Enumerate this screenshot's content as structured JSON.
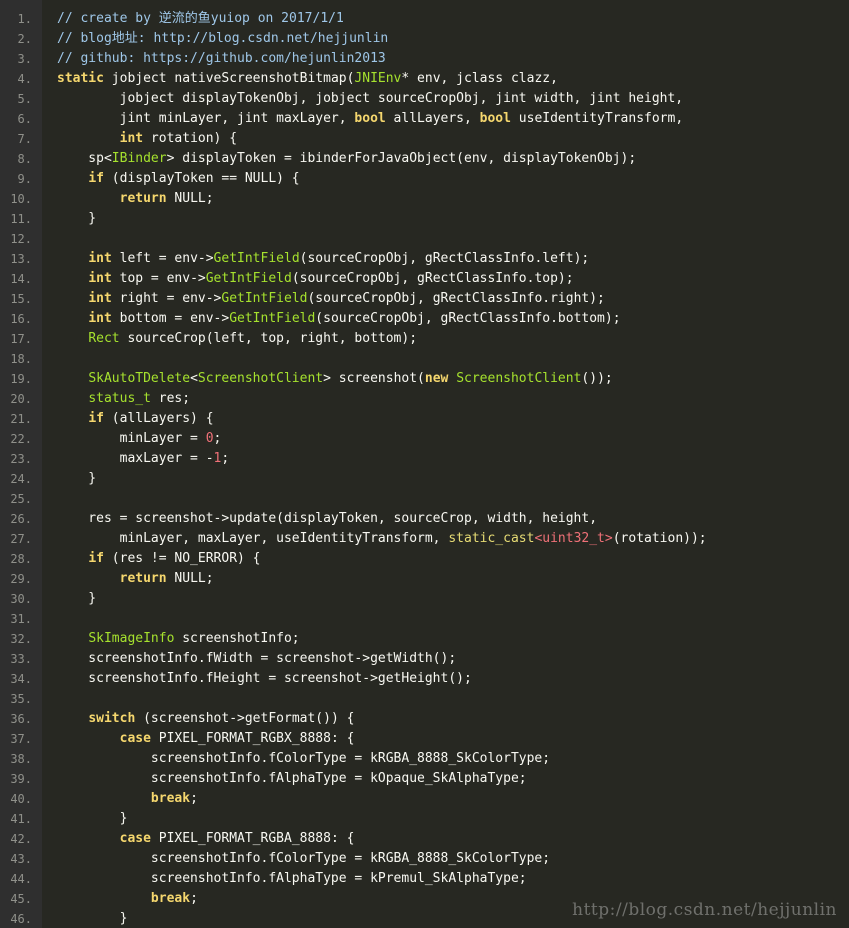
{
  "editor": {
    "lines": [
      {
        "n": "1.",
        "tokens": [
          {
            "t": "// create by 逆流的鱼yuiop on 2017/1/1",
            "c": "comment"
          }
        ]
      },
      {
        "n": "2.",
        "tokens": [
          {
            "t": "// blog地址: http://blog.csdn.net/hejjunlin",
            "c": "comment"
          }
        ]
      },
      {
        "n": "3.",
        "tokens": [
          {
            "t": "// github: https://github.com/hejunlin2013",
            "c": "comment"
          }
        ]
      },
      {
        "n": "4.",
        "tokens": [
          {
            "t": "static",
            "c": "keyword"
          },
          {
            "t": " jobject nativeScreenshotBitmap(",
            "c": "plain"
          },
          {
            "t": "JNIEnv",
            "c": "type"
          },
          {
            "t": "* env, jclass clazz,",
            "c": "plain"
          }
        ]
      },
      {
        "n": "5.",
        "tokens": [
          {
            "t": "        jobject displayTokenObj, jobject sourceCropObj, jint width, jint height,",
            "c": "plain"
          }
        ]
      },
      {
        "n": "6.",
        "tokens": [
          {
            "t": "        jint minLayer, jint maxLayer, ",
            "c": "plain"
          },
          {
            "t": "bool",
            "c": "keyword"
          },
          {
            "t": " allLayers, ",
            "c": "plain"
          },
          {
            "t": "bool",
            "c": "keyword"
          },
          {
            "t": " useIdentityTransform,",
            "c": "plain"
          }
        ]
      },
      {
        "n": "7.",
        "tokens": [
          {
            "t": "        ",
            "c": "plain"
          },
          {
            "t": "int",
            "c": "keyword"
          },
          {
            "t": " rotation) {",
            "c": "plain"
          }
        ]
      },
      {
        "n": "8.",
        "tokens": [
          {
            "t": "    sp<",
            "c": "plain"
          },
          {
            "t": "IBinder",
            "c": "type"
          },
          {
            "t": "> displayToken = ibinderForJavaObject(env, displayTokenObj);",
            "c": "plain"
          }
        ]
      },
      {
        "n": "9.",
        "tokens": [
          {
            "t": "    ",
            "c": "plain"
          },
          {
            "t": "if",
            "c": "keyword"
          },
          {
            "t": " (displayToken == NULL) {",
            "c": "plain"
          }
        ]
      },
      {
        "n": "10.",
        "tokens": [
          {
            "t": "        ",
            "c": "plain"
          },
          {
            "t": "return",
            "c": "keyword"
          },
          {
            "t": " NULL;",
            "c": "plain"
          }
        ]
      },
      {
        "n": "11.",
        "tokens": [
          {
            "t": "    }",
            "c": "plain"
          }
        ]
      },
      {
        "n": "12.",
        "tokens": []
      },
      {
        "n": "13.",
        "tokens": [
          {
            "t": "    ",
            "c": "plain"
          },
          {
            "t": "int",
            "c": "keyword"
          },
          {
            "t": " left = env->",
            "c": "plain"
          },
          {
            "t": "GetIntField",
            "c": "type"
          },
          {
            "t": "(sourceCropObj, gRectClassInfo.left);",
            "c": "plain"
          }
        ]
      },
      {
        "n": "14.",
        "tokens": [
          {
            "t": "    ",
            "c": "plain"
          },
          {
            "t": "int",
            "c": "keyword"
          },
          {
            "t": " top = env->",
            "c": "plain"
          },
          {
            "t": "GetIntField",
            "c": "type"
          },
          {
            "t": "(sourceCropObj, gRectClassInfo.top);",
            "c": "plain"
          }
        ]
      },
      {
        "n": "15.",
        "tokens": [
          {
            "t": "    ",
            "c": "plain"
          },
          {
            "t": "int",
            "c": "keyword"
          },
          {
            "t": " right = env->",
            "c": "plain"
          },
          {
            "t": "GetIntField",
            "c": "type"
          },
          {
            "t": "(sourceCropObj, gRectClassInfo.right);",
            "c": "plain"
          }
        ]
      },
      {
        "n": "16.",
        "tokens": [
          {
            "t": "    ",
            "c": "plain"
          },
          {
            "t": "int",
            "c": "keyword"
          },
          {
            "t": " bottom = env->",
            "c": "plain"
          },
          {
            "t": "GetIntField",
            "c": "type"
          },
          {
            "t": "(sourceCropObj, gRectClassInfo.bottom);",
            "c": "plain"
          }
        ]
      },
      {
        "n": "17.",
        "tokens": [
          {
            "t": "    ",
            "c": "plain"
          },
          {
            "t": "Rect",
            "c": "type"
          },
          {
            "t": " sourceCrop(left, top, right, bottom);",
            "c": "plain"
          }
        ]
      },
      {
        "n": "18.",
        "tokens": []
      },
      {
        "n": "19.",
        "tokens": [
          {
            "t": "    ",
            "c": "plain"
          },
          {
            "t": "SkAutoTDelete",
            "c": "type"
          },
          {
            "t": "<",
            "c": "plain"
          },
          {
            "t": "ScreenshotClient",
            "c": "type"
          },
          {
            "t": "> screenshot(",
            "c": "plain"
          },
          {
            "t": "new",
            "c": "keyword"
          },
          {
            "t": " ",
            "c": "plain"
          },
          {
            "t": "ScreenshotClient",
            "c": "type"
          },
          {
            "t": "());",
            "c": "plain"
          }
        ]
      },
      {
        "n": "20.",
        "tokens": [
          {
            "t": "    ",
            "c": "plain"
          },
          {
            "t": "status_t",
            "c": "type"
          },
          {
            "t": " res;",
            "c": "plain"
          }
        ]
      },
      {
        "n": "21.",
        "tokens": [
          {
            "t": "    ",
            "c": "plain"
          },
          {
            "t": "if",
            "c": "keyword"
          },
          {
            "t": " (allLayers) {",
            "c": "plain"
          }
        ]
      },
      {
        "n": "22.",
        "tokens": [
          {
            "t": "        minLayer = ",
            "c": "plain"
          },
          {
            "t": "0",
            "c": "number"
          },
          {
            "t": ";",
            "c": "plain"
          }
        ]
      },
      {
        "n": "23.",
        "tokens": [
          {
            "t": "        maxLayer = -",
            "c": "plain"
          },
          {
            "t": "1",
            "c": "number"
          },
          {
            "t": ";",
            "c": "plain"
          }
        ]
      },
      {
        "n": "24.",
        "tokens": [
          {
            "t": "    }",
            "c": "plain"
          }
        ]
      },
      {
        "n": "25.",
        "tokens": []
      },
      {
        "n": "26.",
        "tokens": [
          {
            "t": "    res = screenshot->update(displayToken, sourceCrop, width, height,",
            "c": "plain"
          }
        ]
      },
      {
        "n": "27.",
        "tokens": [
          {
            "t": "        minLayer, maxLayer, useIdentityTransform, ",
            "c": "plain"
          },
          {
            "t": "static_cast",
            "c": "macro"
          },
          {
            "t": "<uint32_t>",
            "c": "number"
          },
          {
            "t": "(rotation));",
            "c": "plain"
          }
        ]
      },
      {
        "n": "28.",
        "tokens": [
          {
            "t": "    ",
            "c": "plain"
          },
          {
            "t": "if",
            "c": "keyword"
          },
          {
            "t": " (res != NO_ERROR) {",
            "c": "plain"
          }
        ]
      },
      {
        "n": "29.",
        "tokens": [
          {
            "t": "        ",
            "c": "plain"
          },
          {
            "t": "return",
            "c": "keyword"
          },
          {
            "t": " NULL;",
            "c": "plain"
          }
        ]
      },
      {
        "n": "30.",
        "tokens": [
          {
            "t": "    }",
            "c": "plain"
          }
        ]
      },
      {
        "n": "31.",
        "tokens": []
      },
      {
        "n": "32.",
        "tokens": [
          {
            "t": "    ",
            "c": "plain"
          },
          {
            "t": "SkImageInfo",
            "c": "type"
          },
          {
            "t": " screenshotInfo;",
            "c": "plain"
          }
        ]
      },
      {
        "n": "33.",
        "tokens": [
          {
            "t": "    screenshotInfo.fWidth = screenshot->getWidth();",
            "c": "plain"
          }
        ]
      },
      {
        "n": "34.",
        "tokens": [
          {
            "t": "    screenshotInfo.fHeight = screenshot->getHeight();",
            "c": "plain"
          }
        ]
      },
      {
        "n": "35.",
        "tokens": []
      },
      {
        "n": "36.",
        "tokens": [
          {
            "t": "    ",
            "c": "plain"
          },
          {
            "t": "switch",
            "c": "keyword"
          },
          {
            "t": " (screenshot->getFormat()) {",
            "c": "plain"
          }
        ]
      },
      {
        "n": "37.",
        "tokens": [
          {
            "t": "        ",
            "c": "plain"
          },
          {
            "t": "case",
            "c": "keyword"
          },
          {
            "t": " PIXEL_FORMAT_RGBX_8888: {",
            "c": "plain"
          }
        ]
      },
      {
        "n": "38.",
        "tokens": [
          {
            "t": "            screenshotInfo.fColorType = kRGBA_8888_SkColorType;",
            "c": "plain"
          }
        ]
      },
      {
        "n": "39.",
        "tokens": [
          {
            "t": "            screenshotInfo.fAlphaType = kOpaque_SkAlphaType;",
            "c": "plain"
          }
        ]
      },
      {
        "n": "40.",
        "tokens": [
          {
            "t": "            ",
            "c": "plain"
          },
          {
            "t": "break",
            "c": "keyword"
          },
          {
            "t": ";",
            "c": "plain"
          }
        ]
      },
      {
        "n": "41.",
        "tokens": [
          {
            "t": "        }",
            "c": "plain"
          }
        ]
      },
      {
        "n": "42.",
        "tokens": [
          {
            "t": "        ",
            "c": "plain"
          },
          {
            "t": "case",
            "c": "keyword"
          },
          {
            "t": " PIXEL_FORMAT_RGBA_8888: {",
            "c": "plain"
          }
        ]
      },
      {
        "n": "43.",
        "tokens": [
          {
            "t": "            screenshotInfo.fColorType = kRGBA_8888_SkColorType;",
            "c": "plain"
          }
        ]
      },
      {
        "n": "44.",
        "tokens": [
          {
            "t": "            screenshotInfo.fAlphaType = kPremul_SkAlphaType;",
            "c": "plain"
          }
        ]
      },
      {
        "n": "45.",
        "tokens": [
          {
            "t": "            ",
            "c": "plain"
          },
          {
            "t": "break",
            "c": "keyword"
          },
          {
            "t": ";",
            "c": "plain"
          }
        ]
      },
      {
        "n": "46.",
        "tokens": [
          {
            "t": "        }",
            "c": "plain"
          }
        ]
      }
    ]
  },
  "watermark": {
    "text": "http://blog.csdn.net/hejjunlin"
  },
  "colors": {
    "background": "#272822",
    "gutter": "#2f2f2f",
    "plain": "#f8f8f2",
    "comment": "#9fc7e8",
    "keyword": "#f5d76e",
    "type": "#a6e22e",
    "number": "#f07178"
  }
}
